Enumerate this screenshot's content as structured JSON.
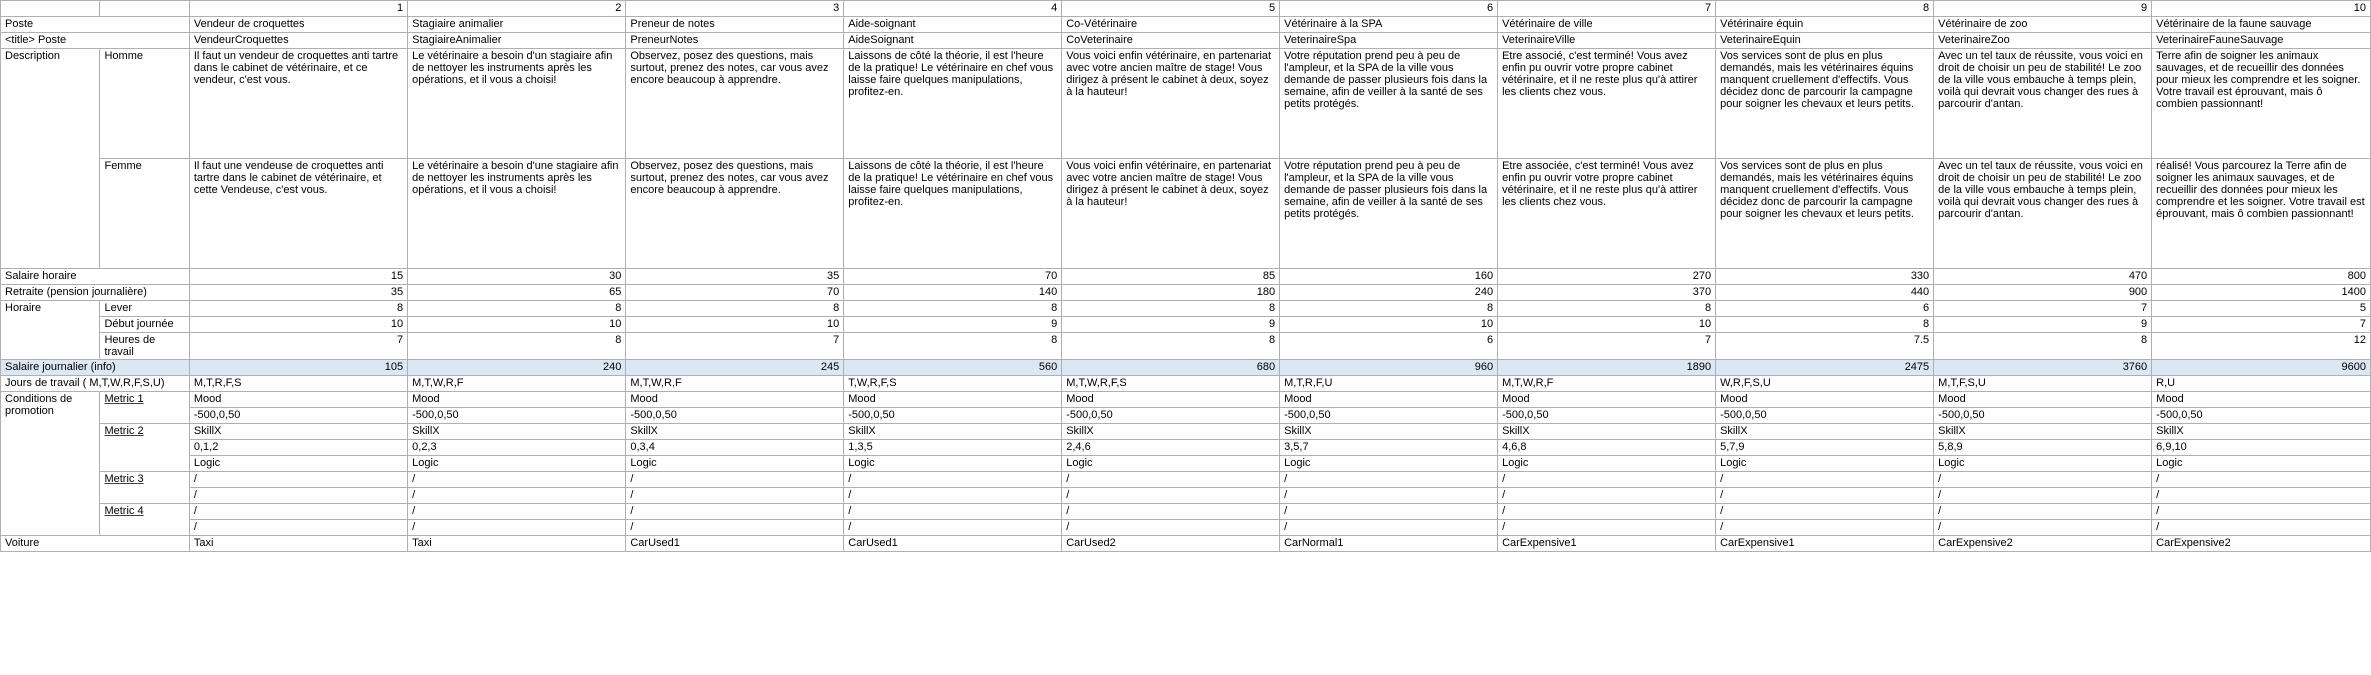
{
  "cols": [
    1,
    2,
    3,
    4,
    5,
    6,
    7,
    8,
    9,
    10
  ],
  "rows": {
    "poste": {
      "label": "Poste",
      "values": [
        "Vendeur de croquettes",
        "Stagiaire animalier",
        "Preneur de notes",
        "Aide-soignant",
        "Co-Vétérinaire",
        "Vétérinaire à la SPA",
        "Vétérinaire de ville",
        "Vétérinaire équin",
        "Vétérinaire de zoo",
        "Vétérinaire de la faune sauvage"
      ]
    },
    "titlePoste": {
      "label": "<title> Poste",
      "values": [
        "VendeurCroquettes",
        "StagiaireAnimalier",
        "PreneurNotes",
        "AideSoignant",
        "CoVeterinaire",
        "VeterinaireSpa",
        "VeterinaireVille",
        "VeterinaireEquin",
        "VeterinaireZoo",
        "VeterinaireFauneSauvage"
      ]
    },
    "description": {
      "label": "Description",
      "homme": {
        "label": "Homme",
        "values": [
          "Il faut un vendeur de croquettes anti tartre dans le cabinet de vétérinaire, et ce vendeur, c'est vous.",
          "Le vétérinaire a besoin d'un stagiaire afin de nettoyer les instruments après les opérations, et il vous a choisi!",
          "Observez, posez des questions, mais surtout, prenez des notes, car vous avez encore beaucoup à apprendre.",
          "Laissons de côté la théorie, il est l'heure de la pratique! Le vétérinaire en chef vous laisse faire quelques manipulations, profitez-en.",
          "Vous voici enfin vétérinaire, en partenariat avec votre ancien maître de stage! Vous dirigez à présent le cabinet à deux, soyez à la hauteur!",
          "Votre réputation prend peu à peu de l'ampleur, et la SPA de la ville vous demande de passer plusieurs fois dans la semaine, afin de veiller à la santé de ses petits protégés.",
          "Etre associé, c'est terminé! Vous avez enfin pu ouvrir votre propre cabinet vétérinaire, et il ne reste plus qu'à attirer les clients chez vous.",
          "Vos services sont de plus en plus demandés, mais les vétérinaires équins manquent cruellement d'effectifs. Vous décidez donc de parcourir la campagne pour soigner les chevaux et leurs petits.",
          "Avec un tel taux de réussite, vous voici en droit de choisir un peu de stabilité! Le zoo de la ville vous embauche à temps plein, voilà qui devrait vous changer des rues à parcourir d'antan.",
          "Terre afin de soigner les animaux sauvages, et de recueillir des données pour mieux les comprendre et les soigner. Votre travail est éprouvant, mais ô combien passionnant!"
        ]
      },
      "femme": {
        "label": "Femme",
        "values": [
          "Il faut une vendeuse de croquettes anti tartre dans le cabinet de vétérinaire, et cette Vendeuse, c'est vous.",
          "Le vétérinaire a besoin d'une stagiaire afin de nettoyer les instruments après les opérations, et il vous a choisi!",
          "Observez, posez des questions, mais surtout, prenez des notes, car vous avez encore beaucoup à apprendre.",
          "Laissons de côté la théorie, il est l'heure de la pratique! Le vétérinaire en chef vous laisse faire quelques manipulations, profitez-en.",
          "Vous voici enfin vétérinaire, en partenariat avec votre ancien maître de stage! Vous dirigez à présent le cabinet à deux, soyez à la hauteur!",
          "Votre réputation prend peu à peu de l'ampleur, et la SPA de la ville vous demande de passer plusieurs fois dans la semaine, afin de veiller à la santé de ses petits protégés.",
          "Etre associée, c'est terminé! Vous avez enfin pu ouvrir votre propre cabinet vétérinaire, et il ne reste plus qu'à attirer les clients chez vous.",
          "Vos services sont de plus en plus demandés, mais les vétérinaires équins manquent cruellement d'effectifs. Vous décidez donc de parcourir la campagne pour soigner les chevaux et leurs petits.",
          "Avec un tel taux de réussite, vous voici en droit de choisir un peu de stabilité! Le zoo de la ville vous embauche à temps plein, voilà qui devrait vous changer des rues à parcourir d'antan.",
          "réalisé! Vous parcourez la Terre afin de soigner les animaux sauvages, et de recueillir des données pour mieux les comprendre et les soigner. Votre travail est éprouvant, mais ô combien passionnant!"
        ]
      }
    },
    "salaireHoraire": {
      "label": "Salaire horaire",
      "values": [
        15,
        30,
        35,
        70,
        85,
        160,
        270,
        330,
        470,
        800
      ]
    },
    "retraite": {
      "label": "Retraite (pension journalière)",
      "values": [
        35,
        65,
        70,
        140,
        180,
        240,
        370,
        440,
        900,
        1400
      ]
    },
    "horaire": {
      "label": "Horaire",
      "lever": {
        "label": "Lever",
        "values": [
          8,
          8,
          8,
          8,
          8,
          8,
          8,
          6,
          7,
          5
        ]
      },
      "debut": {
        "label": "Début journée",
        "values": [
          10,
          10,
          10,
          9,
          9,
          10,
          10,
          8,
          9,
          7
        ]
      },
      "heures": {
        "label": "Heures de travail",
        "values": [
          7,
          8,
          7,
          8,
          8,
          6,
          7,
          7.5,
          8,
          12
        ]
      }
    },
    "salaireJournalier": {
      "label": "Salaire journalier (info)",
      "values": [
        105,
        240,
        245,
        560,
        680,
        960,
        1890,
        2475,
        3760,
        9600
      ]
    },
    "joursTravail": {
      "label": "Jours de travail   ( M,T,W,R,F,S,U)",
      "values": [
        "M,T,R,F,S",
        "M,T,W,R,F",
        "M,T,W,R,F",
        "T,W,R,F,S",
        "M,T,W,R,F,S",
        "M,T,R,F,U",
        "M,T,W,R,F",
        "W,R,F,S,U",
        "M,T,F,S,U",
        "R,U"
      ]
    },
    "conditions": {
      "label": "Conditions de promotion",
      "metric1": {
        "label": "Metric 1",
        "line1": [
          "Mood",
          "Mood",
          "Mood",
          "Mood",
          "Mood",
          "Mood",
          "Mood",
          "Mood",
          "Mood",
          "Mood"
        ],
        "line2": [
          "-500,0,50",
          "-500,0,50",
          "-500,0,50",
          "-500,0,50",
          "-500,0,50",
          "-500,0,50",
          "-500,0,50",
          "-500,0,50",
          "-500,0,50",
          "-500,0,50"
        ]
      },
      "metric2": {
        "label": "Metric 2",
        "line1": [
          "SkillX",
          "SkillX",
          "SkillX",
          "SkillX",
          "SkillX",
          "SkillX",
          "SkillX",
          "SkillX",
          "SkillX",
          "SkillX"
        ],
        "line2": [
          "0,1,2",
          "0,2,3",
          "0,3,4",
          "1,3,5",
          "2,4,6",
          "3,5,7",
          "4,6,8",
          "5,7,9",
          "5,8,9",
          "6,9,10"
        ],
        "line3": [
          "Logic",
          "Logic",
          "Logic",
          "Logic",
          "Logic",
          "Logic",
          "Logic",
          "Logic",
          "Logic",
          "Logic"
        ]
      },
      "metric3": {
        "label": "Metric 3",
        "line1": [
          "/",
          "/",
          "/",
          "/",
          "/",
          "/",
          "/",
          "/",
          "/",
          "/"
        ],
        "line2": [
          "/",
          "/",
          "/",
          "/",
          "/",
          "/",
          "/",
          "/",
          "/",
          "/"
        ]
      },
      "metric4": {
        "label": "Metric 4",
        "line1": [
          "/",
          "/",
          "/",
          "/",
          "/",
          "/",
          "/",
          "/",
          "/",
          "/"
        ],
        "line2": [
          "/",
          "/",
          "/",
          "/",
          "/",
          "/",
          "/",
          "/",
          "/",
          "/"
        ]
      }
    },
    "voiture": {
      "label": "Voiture",
      "values": [
        "Taxi",
        "Taxi",
        "CarUsed1",
        "CarUsed1",
        "CarUsed2",
        "CarNormal1",
        "CarExpensive1",
        "CarExpensive1",
        "CarExpensive2",
        "CarExpensive2"
      ]
    }
  }
}
